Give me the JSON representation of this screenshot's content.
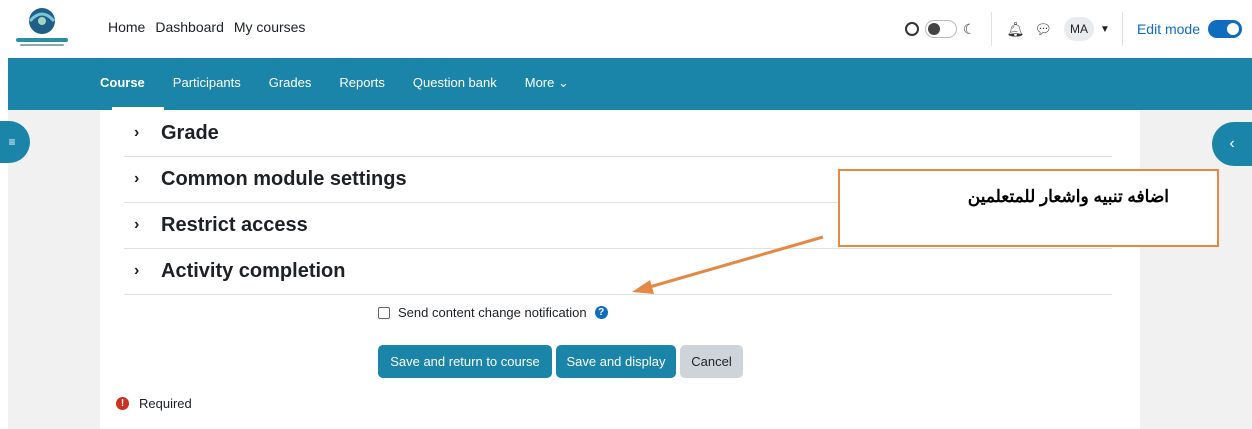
{
  "topnav": {
    "links": [
      "Home",
      "Dashboard",
      "My courses"
    ],
    "avatar_initials": "MA",
    "edit_mode_label": "Edit mode",
    "edit_mode_on": true,
    "dark_mode_on": false
  },
  "secondary_nav": {
    "items": [
      "Course",
      "Participants",
      "Grades",
      "Reports",
      "Question bank",
      "More ⌄"
    ],
    "active": "Course"
  },
  "sections": [
    "Grade",
    "Common module settings",
    "Restrict access",
    "Activity completion"
  ],
  "notification": {
    "checkbox_label": "Send content change notification",
    "checked": false
  },
  "buttons": {
    "save_return": "Save and return to course",
    "save_display": "Save and display",
    "cancel": "Cancel"
  },
  "required_label": "Required",
  "callout": {
    "text": "اضافه تنبيه واشعار للمتعلمين"
  },
  "colors": {
    "brand": "#1a85a8",
    "link": "#0f6cbf",
    "callout_border": "#e48843",
    "required_icon": "#ca3120"
  }
}
